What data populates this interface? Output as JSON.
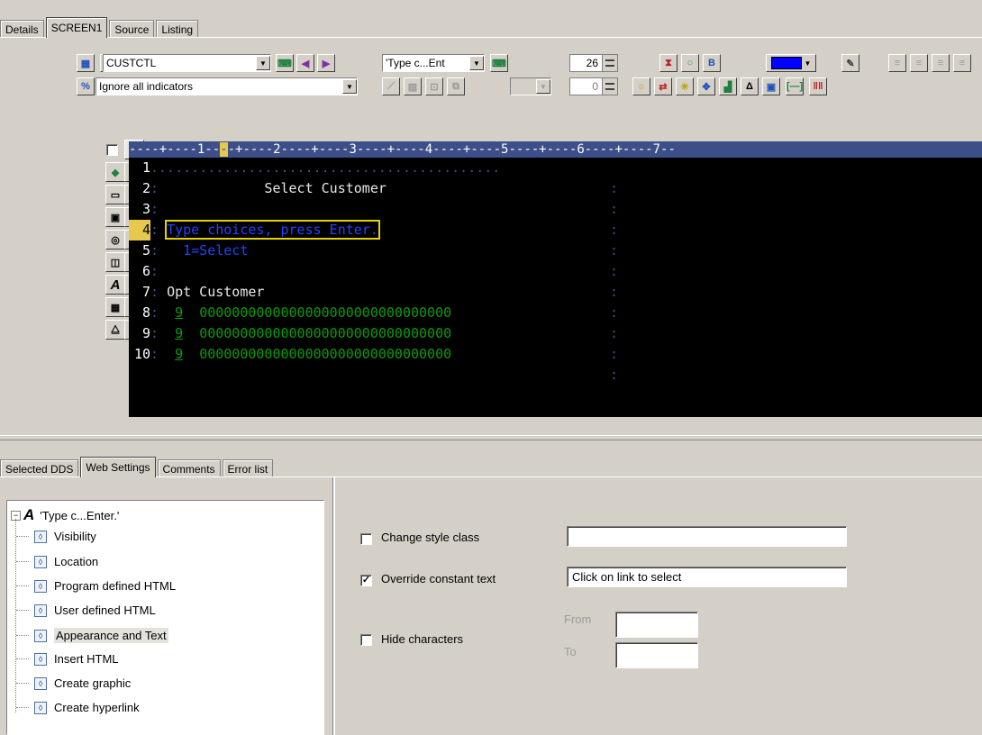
{
  "top_tabs": [
    "Details",
    "SCREEN1",
    "Source",
    "Listing"
  ],
  "toolbar": {
    "record_combo": "CUSTCTL",
    "field_combo": "'Type c...Ent",
    "indicator_combo": "Ignore all indicators",
    "row_value": "26",
    "col_value": "0"
  },
  "ruler": "----+----1--",
  "ruler_cursor": "-",
  "ruler_rest": "-+----2----+----3----+----4----+----5----+----6----+----7--",
  "screen": {
    "lines": [
      {
        "num": "1",
        "dots": "..........................................."
      },
      {
        "num": "2",
        "text": "             Select Customer"
      },
      {
        "num": "3"
      },
      {
        "num": "4",
        "text": "Type choices, press Enter."
      },
      {
        "num": "5",
        "text": "  1=Select"
      },
      {
        "num": "6"
      },
      {
        "num": "7",
        "text": "Opt Customer"
      },
      {
        "num": "8",
        "opt": "9",
        "text": "0000000000000000000000000000000"
      },
      {
        "num": "9",
        "opt": "9",
        "text": "0000000000000000000000000000000"
      },
      {
        "num": "10",
        "opt": "9",
        "text": "0000000000000000000000000000000"
      }
    ]
  },
  "bottom_tabs": [
    "Selected DDS",
    "Web Settings",
    "Comments",
    "Error list"
  ],
  "tree": {
    "root": "'Type c...Enter.'",
    "items": [
      "Visibility",
      "Location",
      "Program defined HTML",
      "User defined HTML",
      "Appearance and Text",
      "Insert HTML",
      "Create graphic",
      "Create hyperlink"
    ]
  },
  "settings": {
    "change_style_label": "Change style class",
    "change_style_value": "",
    "override_label": "Override constant text",
    "override_value": "Click on link to select",
    "hide_label": "Hide characters",
    "from_label": "From",
    "to_label": "To",
    "from_value": "",
    "to_value": ""
  }
}
